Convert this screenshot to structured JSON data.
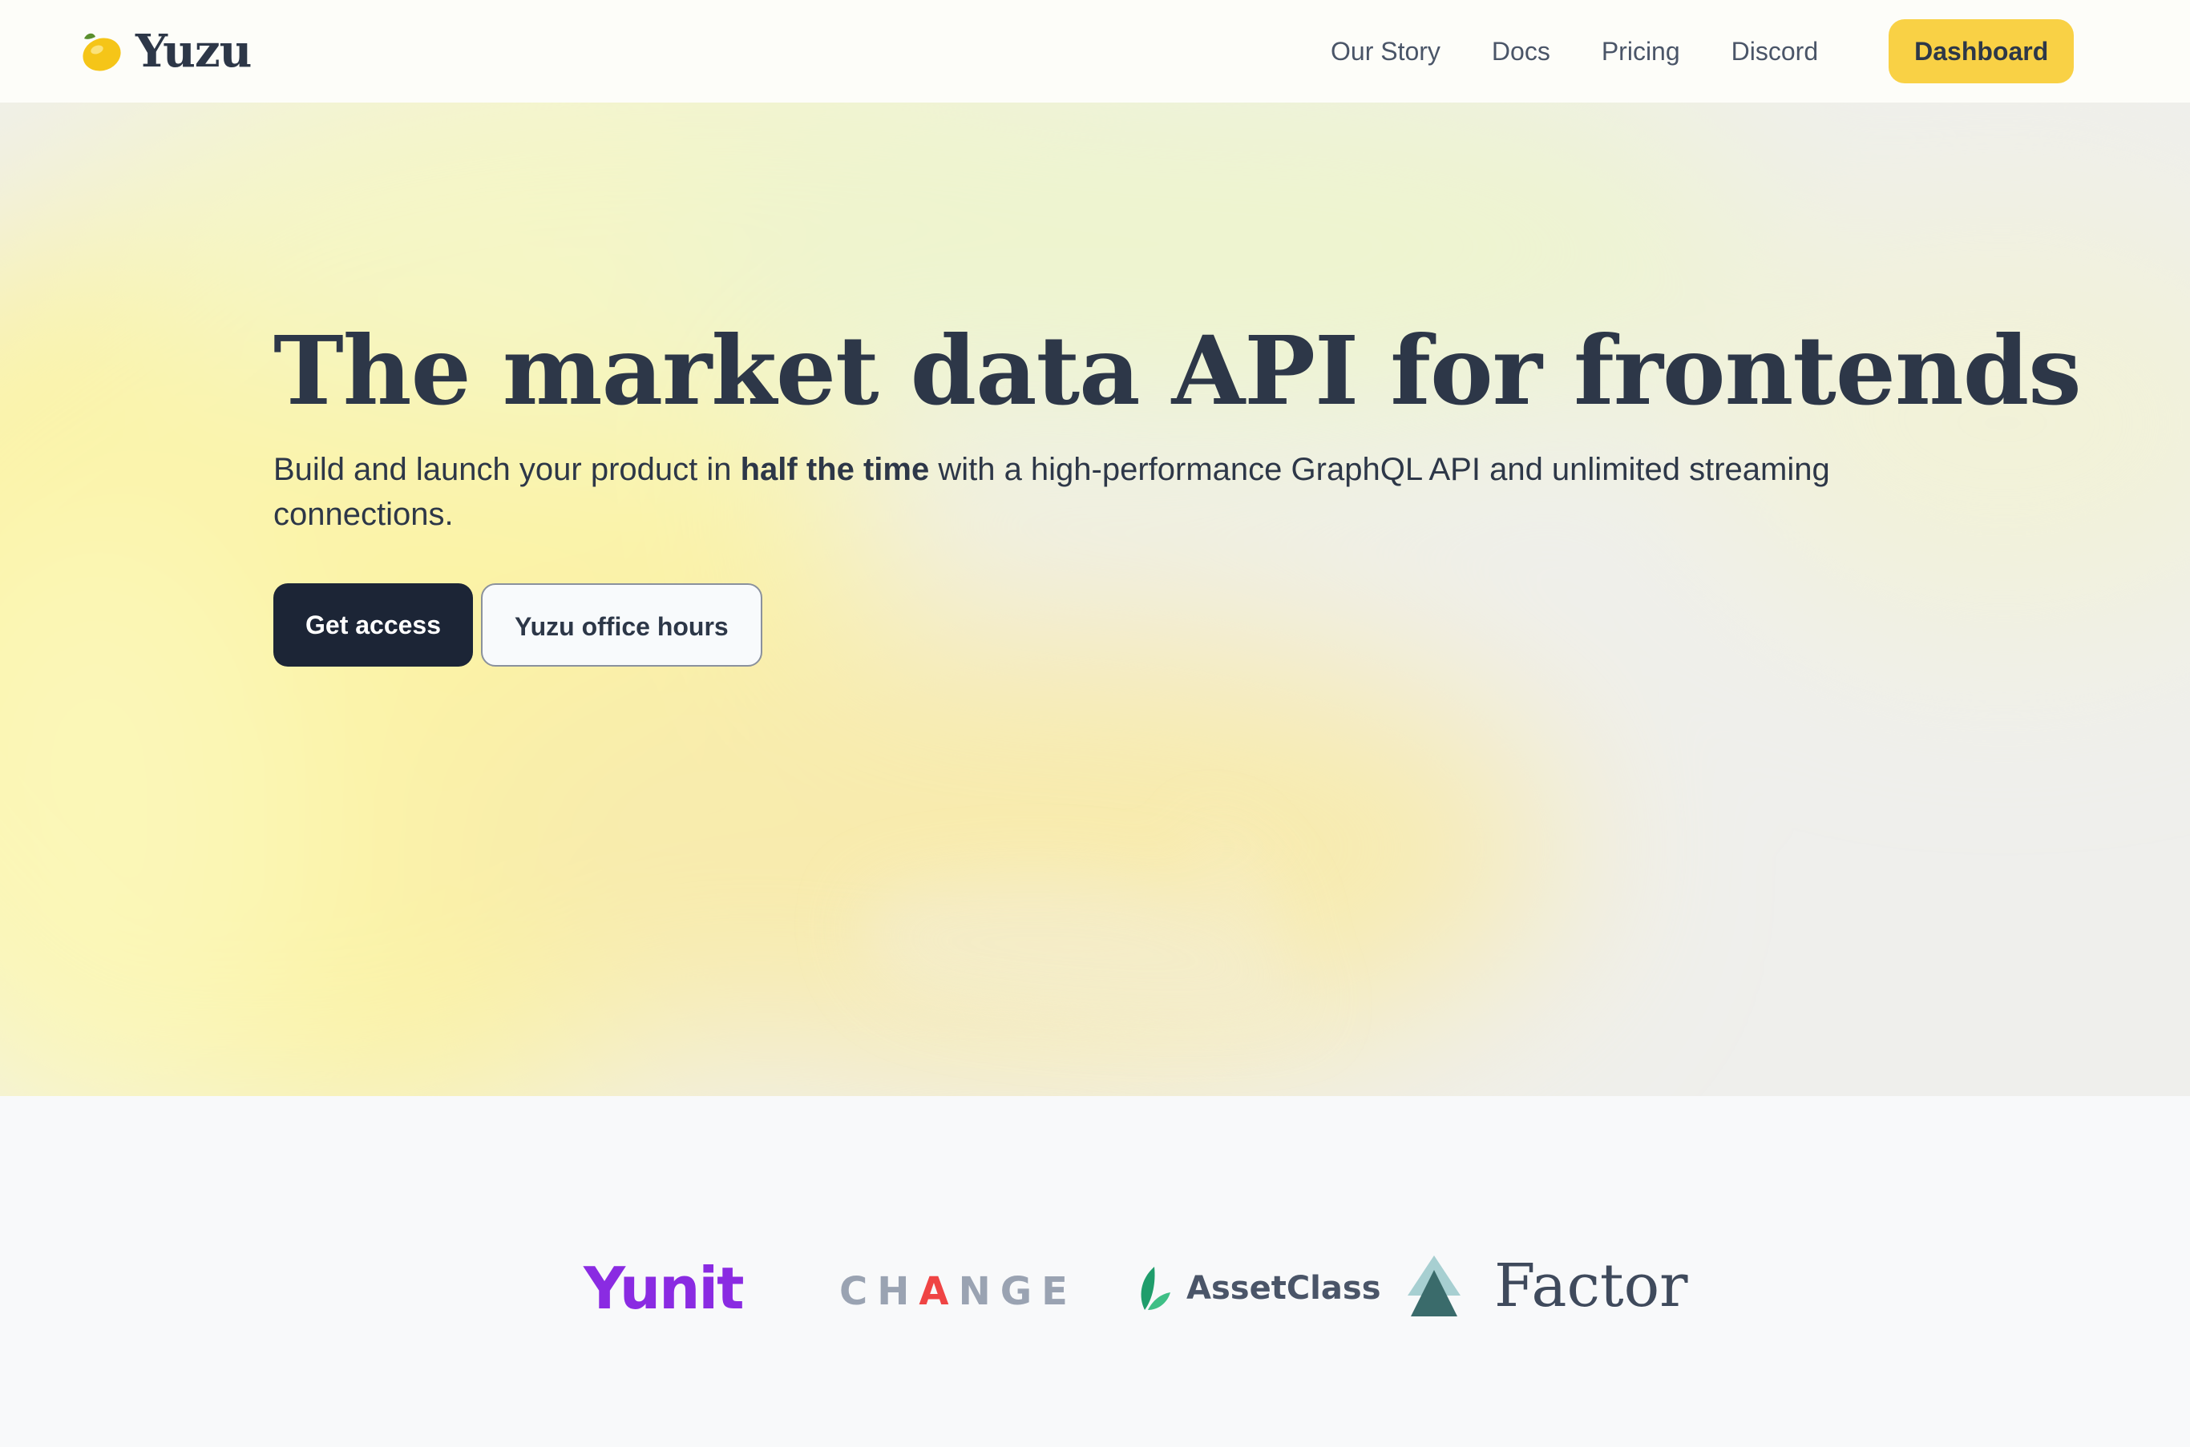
{
  "header": {
    "brand_icon": "lemon-icon",
    "brand_name": "Yuzu",
    "nav": [
      {
        "label": "Our Story"
      },
      {
        "label": "Docs"
      },
      {
        "label": "Pricing"
      },
      {
        "label": "Discord"
      }
    ],
    "cta_label": "Dashboard",
    "cta_color": "#f9d145"
  },
  "hero": {
    "headline": "The market data API for frontends",
    "sub_before": "Build and launch your product in ",
    "sub_bold": "half the time",
    "sub_after": " with a high-performance GraphQL API and unlimited streaming connections.",
    "primary_label": "Get access",
    "secondary_label": "Yuzu office hours",
    "primary_color": "#1c2536"
  },
  "logos": {
    "items": [
      {
        "name": "Yunit",
        "color": "#8a2be2"
      },
      {
        "name_before": "CH",
        "name_mark": "A",
        "name_after": "NGE",
        "color": "#9aa3b2"
      },
      {
        "name": "AssetClass",
        "icon": "leaf-icon",
        "color": "#4a5568"
      },
      {
        "name": "Factor",
        "icon": "triangle-mark-icon",
        "color": "#3f4a5c"
      }
    ]
  }
}
